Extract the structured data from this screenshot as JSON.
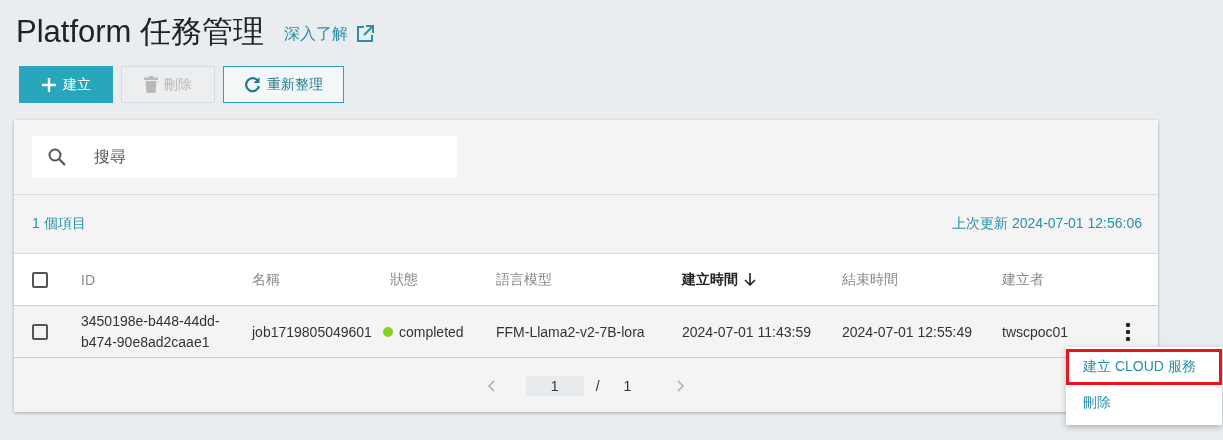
{
  "title": "Platform 任務管理",
  "learn_more": "深入了解",
  "toolbar": [
    {
      "kind": "create",
      "label": "建立",
      "disabled": false
    },
    {
      "kind": "delete",
      "label": "刪除",
      "disabled": true
    },
    {
      "kind": "refresh",
      "label": "重新整理",
      "disabled": false
    }
  ],
  "search": {
    "placeholder": "搜尋"
  },
  "item_count": "1 個項目",
  "last_updated": "上次更新 2024-07-01 12:56:06",
  "table": {
    "select_all": {
      "checked": false
    },
    "columns": [
      {
        "label": "ID",
        "sorted": false
      },
      {
        "label": "名稱",
        "sorted": false
      },
      {
        "label": "狀態",
        "sorted": false
      },
      {
        "label": "語言模型",
        "sorted": false
      },
      {
        "label": "建立時間",
        "sorted": true
      },
      {
        "label": "結束時間",
        "sorted": false
      },
      {
        "label": "建立者",
        "sorted": false
      }
    ],
    "rows": [
      {
        "checked": false,
        "id": "3450198e-b448-44dd-b474-90e8ad2caae1",
        "name": "job1719805049601",
        "status": "completed",
        "color": "#7ed321",
        "model": "FFM-Llama2-v2-7B-lora",
        "created": "2024-07-01 11:43:59",
        "ended": "2024-07-01 12:55:49",
        "creator": "twscpoc01"
      }
    ]
  },
  "pagination": {
    "page": "1",
    "separator": "/",
    "total": "1"
  },
  "row_menu": [
    {
      "label": "建立 CLOUD 服務",
      "highlighted": true
    },
    {
      "label": "刪除",
      "highlighted": false
    }
  ]
}
